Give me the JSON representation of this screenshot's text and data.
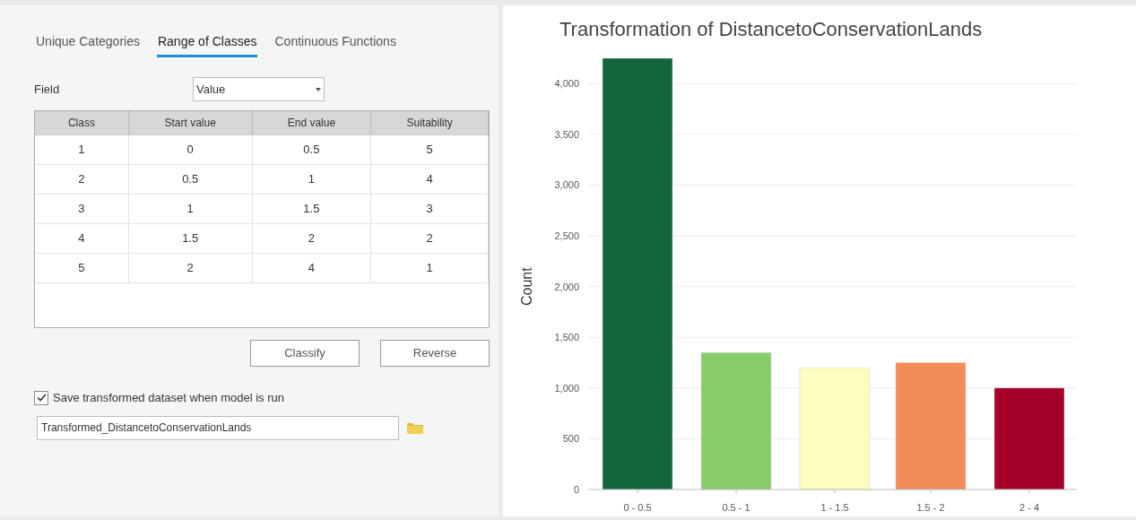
{
  "tabs": [
    {
      "label": "Unique Categories",
      "selected": false
    },
    {
      "label": "Range of Classes",
      "selected": true
    },
    {
      "label": "Continuous Functions",
      "selected": false
    }
  ],
  "field": {
    "label": "Field",
    "value": "Value"
  },
  "table": {
    "columns": [
      "Class",
      "Start value",
      "End value",
      "Suitability"
    ],
    "rows": [
      [
        "1",
        "0",
        "0.5",
        "5"
      ],
      [
        "2",
        "0.5",
        "1",
        "4"
      ],
      [
        "3",
        "1",
        "1.5",
        "3"
      ],
      [
        "4",
        "1.5",
        "2",
        "2"
      ],
      [
        "5",
        "2",
        "4",
        "1"
      ]
    ]
  },
  "buttons": [
    "Classify",
    "Reverse"
  ],
  "save_option": {
    "label": "Save transformed dataset when model is run",
    "checked": true
  },
  "output_field": {
    "value": "Transformed_DistancetoConservationLands"
  },
  "chart": {
    "chart_data": {
      "type": "bar",
      "title": "Transformation of DistancetoConservationLands",
      "ylabel": "Count",
      "categories": [
        "0 - 0.5",
        "0.5 - 1",
        "1 - 1.5",
        "1.5 - 2",
        "2 - 4"
      ],
      "values": [
        4250,
        1350,
        1200,
        1250,
        1000
      ],
      "grid": true,
      "colors": [
        "#13653a",
        "#88cc6c",
        "#fdfdc0",
        "#f28c58",
        "#a3002a"
      ],
      "ylim": [
        0,
        4250
      ],
      "yticks": [
        {
          "value": 0,
          "label": "0"
        },
        {
          "value": 500,
          "label": "500"
        },
        {
          "value": 1000,
          "label": "1,000"
        },
        {
          "value": 1500,
          "label": "1,500"
        },
        {
          "value": 2000,
          "label": "2,000"
        },
        {
          "value": 2500,
          "label": "2,500"
        },
        {
          "value": 3000,
          "label": "3,000"
        },
        {
          "value": 3500,
          "label": "3,500"
        },
        {
          "value": 4000,
          "label": "4,000"
        }
      ]
    }
  }
}
